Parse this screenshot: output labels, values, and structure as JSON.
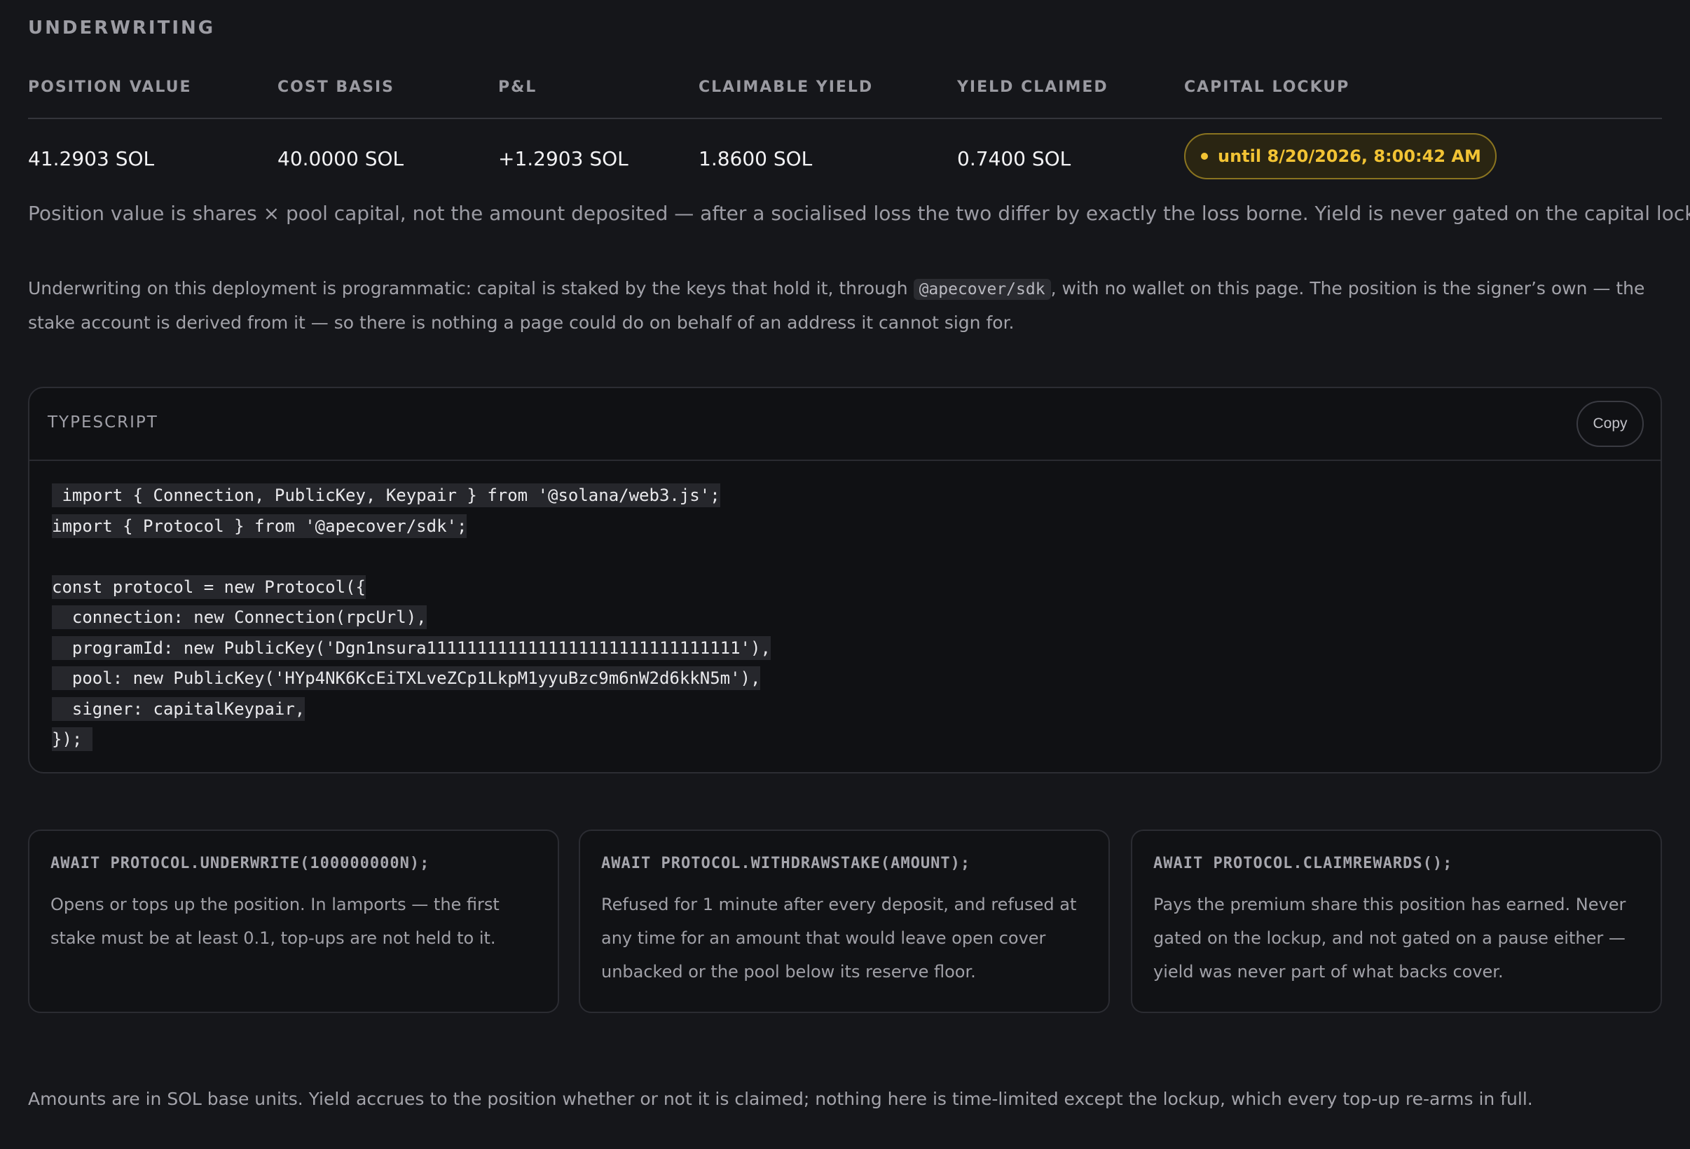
{
  "section": {
    "title": "UNDERWRITING"
  },
  "stats": {
    "headers": [
      "POSITION VALUE",
      "COST BASIS",
      "P&L",
      "CLAIMABLE YIELD",
      "YIELD CLAIMED",
      "CAPITAL LOCKUP"
    ],
    "values": [
      "41.2903 SOL",
      "40.0000 SOL",
      "+1.2903 SOL",
      "1.8600 SOL",
      "0.7400 SOL"
    ],
    "lockup": "until 8/20/2026, 8:00:42 AM",
    "colors": {
      "lockup_accent": "#f2c334",
      "lockup_bg": "#2a2512"
    }
  },
  "note_big": "Position value is shares × pool capital, not the amount deposited — after a socialised loss the two differ by exactly the loss borne. Yield is never gated on the capital lockup.",
  "intro": {
    "before": "Underwriting on this deployment is programmatic: capital is staked by the keys that hold it, through ",
    "code": "@apecover/sdk",
    "after": ", with no wallet on this page. The position is the signer’s own — the stake account is derived from it — so there is nothing a page could do on behalf of an address it cannot sign for."
  },
  "code_block": {
    "language": "TYPESCRIPT",
    "copy_label": "Copy",
    "lines": [
      " import { Connection, PublicKey, Keypair } from '@solana/web3.js';",
      "import { Protocol } from '@apecover/sdk';",
      "",
      "const protocol = new Protocol({",
      "  connection: new Connection(rpcUrl),",
      "  programId: new PublicKey('Dgn1nsura1111111111111111111111111111111'),",
      "  pool: new PublicKey('HYp4NK6KcEiTXLveZCp1LkpM1yyuBzc9m6nW2d6kkN5m'),",
      "  signer: capitalKeypair,",
      "}); "
    ]
  },
  "cards": [
    {
      "title": "AWAIT PROTOCOL.UNDERWRITE(100000000N);",
      "body": "Opens or tops up the position. In lamports — the first stake must be at least 0.1, top-ups are not held to it."
    },
    {
      "title": "AWAIT PROTOCOL.WITHDRAWSTAKE(AMOUNT);",
      "body": "Refused for 1 minute after every deposit, and refused at any time for an amount that would leave open cover unbacked or the pool below its reserve floor."
    },
    {
      "title": "AWAIT PROTOCOL.CLAIMREWARDS();",
      "body": "Pays the premium share this position has earned. Never gated on the lockup, and not gated on a pause either — yield was never part of what backs cover."
    }
  ],
  "footer_note": "Amounts are in SOL base units. Yield accrues to the position whether or not it is claimed; nothing here is time-limited except the lockup, which every top-up re-arms in full."
}
